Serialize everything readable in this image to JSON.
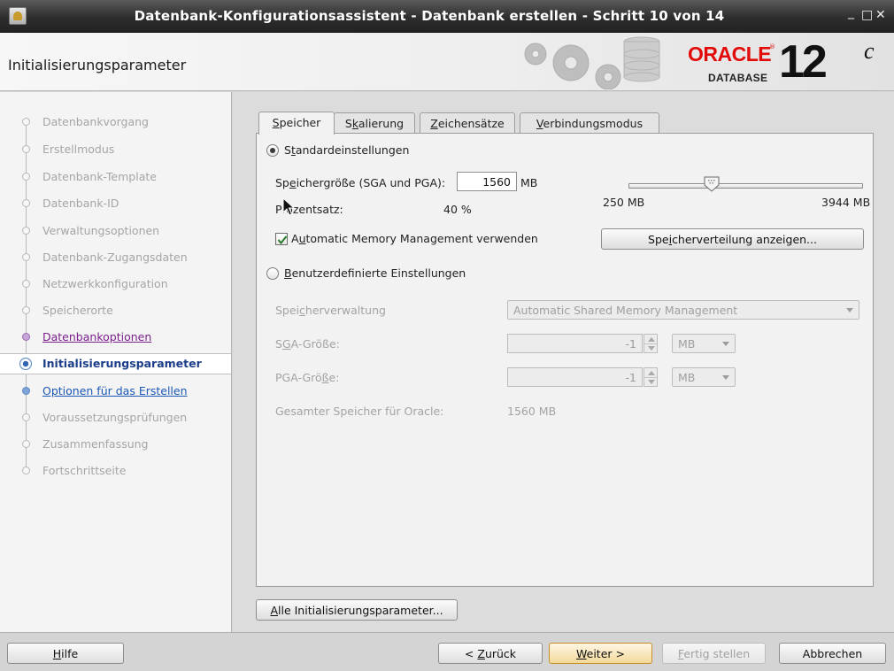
{
  "window": {
    "title": "Datenbank-Konfigurationsassistent - Datenbank erstellen - Schritt 10 von 14",
    "minimize": "_",
    "maximize": "□",
    "close": "✕"
  },
  "header": {
    "page_title": "Initialisierungsparameter",
    "logo_word": "ORACLE",
    "logo_reg": "®",
    "logo_sub": "DATABASE",
    "version": "12",
    "version_suffix": "c"
  },
  "nav": {
    "items": [
      {
        "label": "Datenbankvorgang",
        "state": "disabled"
      },
      {
        "label": "Erstellmodus",
        "state": "disabled"
      },
      {
        "label": "Datenbank-Template",
        "state": "disabled"
      },
      {
        "label": "Datenbank-ID",
        "state": "disabled"
      },
      {
        "label": "Verwaltungsoptionen",
        "state": "disabled"
      },
      {
        "label": "Datenbank-Zugangsdaten",
        "state": "disabled"
      },
      {
        "label": "Netzwerkkonfiguration",
        "state": "disabled"
      },
      {
        "label": "Speicherorte",
        "state": "disabled"
      },
      {
        "label": "Datenbankoptionen",
        "state": "done"
      },
      {
        "label": "Initialisierungsparameter",
        "state": "current"
      },
      {
        "label": "Optionen für das Erstellen",
        "state": "next"
      },
      {
        "label": "Voraussetzungsprüfungen",
        "state": "disabled"
      },
      {
        "label": "Zusammenfassung",
        "state": "disabled"
      },
      {
        "label": "Fortschrittseite",
        "state": "disabled"
      }
    ]
  },
  "tabs": [
    {
      "pre": "",
      "mn": "S",
      "post": "peicher",
      "active": true
    },
    {
      "pre": "S",
      "mn": "k",
      "post": "alierung",
      "active": false
    },
    {
      "pre": "",
      "mn": "Z",
      "post": "eichensätze",
      "active": false
    },
    {
      "pre": "",
      "mn": "V",
      "post": "erbindungsmodus",
      "active": false
    }
  ],
  "memory": {
    "standard_radio": {
      "pre": "S",
      "mn": "t",
      "post": "andardeinstellungen",
      "checked": true
    },
    "size_label": {
      "pre": "Sp",
      "mn": "e",
      "post": "ichergröße (SGA und PGA):"
    },
    "size_value": "1560",
    "size_unit": "MB",
    "percent_label": "Prozentsatz:",
    "percent_value": "40 %",
    "slider_min": "250 MB",
    "slider_max": "3944 MB",
    "slider_fraction": 0.354,
    "amm_checkbox": {
      "pre": "A",
      "mn": "u",
      "post": "tomatic Memory Management verwenden",
      "checked": true
    },
    "show_distribution_button": {
      "pre": "Spe",
      "mn": "i",
      "post": "cherverteilung anzeigen..."
    },
    "custom_radio": {
      "pre": "",
      "mn": "B",
      "post": "enutzerdefinierte Einstellungen",
      "checked": false
    },
    "mgmt_label": {
      "pre": "Spei",
      "mn": "c",
      "post": "herverwaltung"
    },
    "mgmt_value": "Automatic Shared Memory Management",
    "sga_label": {
      "pre": "S",
      "mn": "G",
      "post": "A-Größe:"
    },
    "sga_value": "-1",
    "sga_unit": "MB",
    "pga_label": {
      "pre": "PGA-Grö",
      "mn": "ß",
      "post": "e:"
    },
    "pga_value": "-1",
    "pga_unit": "MB",
    "total_label": "Gesamter Speicher für Oracle:",
    "total_value": "1560 MB"
  },
  "all_params_button": {
    "pre": "",
    "mn": "A",
    "post": "lle Initialisierungsparameter..."
  },
  "footer": {
    "help": {
      "pre": "",
      "mn": "H",
      "post": "ilfe"
    },
    "back": {
      "pre": "< ",
      "mn": "Z",
      "post": "urück"
    },
    "next": {
      "pre": "",
      "mn": "W",
      "post": "eiter >"
    },
    "finish": {
      "pre": "",
      "mn": "F",
      "post": "ertig stellen"
    },
    "cancel": "Abbrechen"
  },
  "colors": {
    "accent": "#c8902a",
    "current_step": "#1c3e8a",
    "done_step": "#7a1f8c",
    "oracle_red": "#e30a0a"
  }
}
